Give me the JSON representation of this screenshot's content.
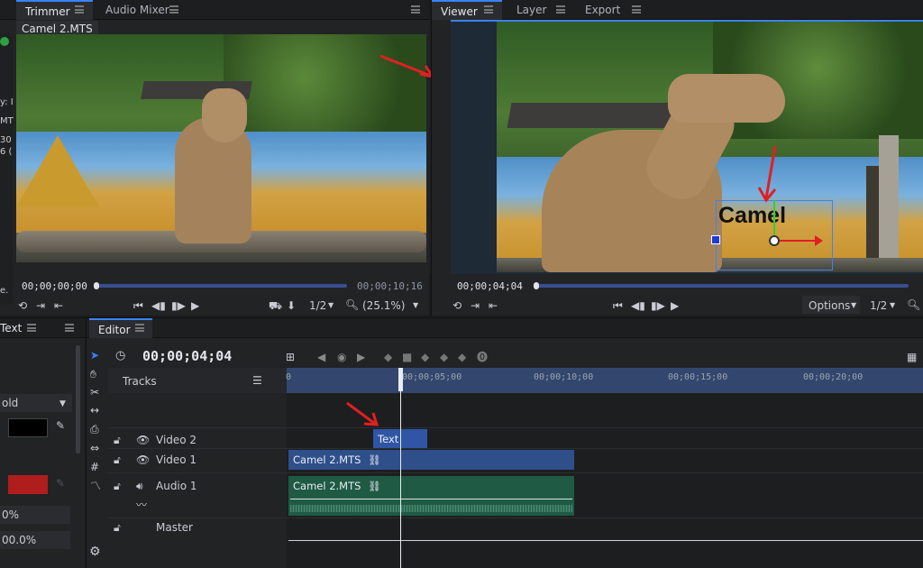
{
  "trimmer": {
    "tabs": [
      "Trimmer",
      "Audio Mixer"
    ],
    "clip_label": "Camel 2.MTS",
    "timecode_in": "00;00;00;00",
    "timecode_out": "00;00;10;16",
    "zoom_ratio": "1/2",
    "zoom_percent": "(25.1%)"
  },
  "viewer": {
    "tabs": [
      "Viewer",
      "Layer",
      "Export"
    ],
    "overlay_text": "Camel",
    "timecode": "00;00;04;04",
    "options_label": "Options",
    "zoom_ratio": "1/2"
  },
  "left_panel": {
    "tab": "Text",
    "font_style": "old",
    "value1": "0%",
    "value2": "00.0%",
    "colors": {
      "text": "#000000",
      "outline": "#b01d1d"
    }
  },
  "left_edge_fragments": [
    "y: I",
    "MT",
    "30",
    "6 (",
    "e."
  ],
  "editor": {
    "tab": "Editor",
    "timecode": "00;00;04;04",
    "tracks_label": "Tracks",
    "ruler": [
      "0",
      "00;00;05;00",
      "00;00;10;00",
      "00;00;15;00",
      "00;00;20;00"
    ],
    "tracks": [
      {
        "name": "Video 2",
        "clip": "Text"
      },
      {
        "name": "Video 1",
        "clip": "Camel 2.MTS"
      },
      {
        "name": "Audio 1",
        "clip": "Camel 2.MTS"
      },
      {
        "name": "Master",
        "clip": ""
      }
    ]
  },
  "accent_colors": {
    "playhead": "#dfe3ea",
    "video_clip": "#2e4f8a",
    "audio_clip": "#1f5a44",
    "selection": "#3b82f6"
  }
}
